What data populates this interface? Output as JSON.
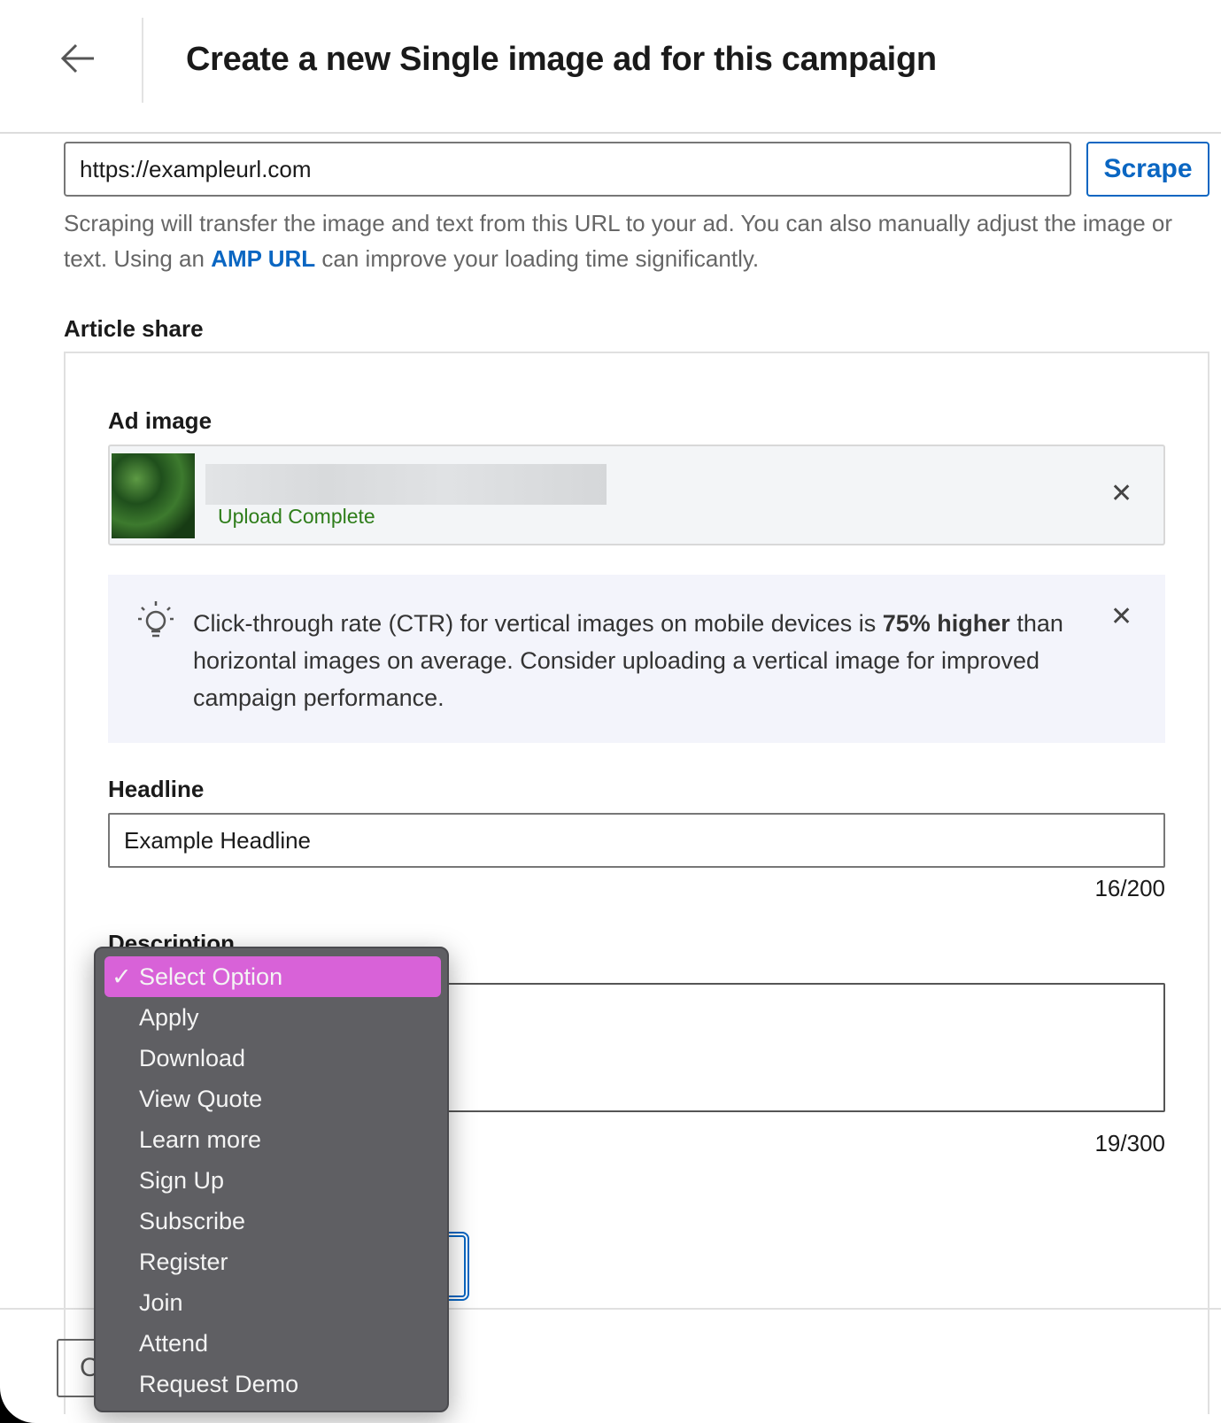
{
  "header": {
    "title": "Create a new Single image ad for this campaign",
    "back_icon": "arrow-left-icon"
  },
  "url": {
    "value": "https://exampleurl.com",
    "scrape_label": "Scrape"
  },
  "help": {
    "before": "Scraping will transfer the image and text from this URL to your ad. You can also manually adjust the image or text. Using an ",
    "link": "AMP URL",
    "after": " can improve your loading time significantly."
  },
  "article_share": {
    "label": "Article share"
  },
  "ad_image": {
    "label": "Ad image",
    "status": "Upload Complete"
  },
  "tip": {
    "before": "Click-through rate (CTR) for vertical images on mobile devices is ",
    "bold": "75% higher",
    "after": " than horizontal images on average. Consider uploading a vertical image for improved campaign performance."
  },
  "headline": {
    "label": "Headline",
    "value": "Example Headline",
    "counter": "16/200"
  },
  "description": {
    "label": "Description",
    "counter": "19/300"
  },
  "footer": {
    "cancel_partial": "C"
  },
  "dropdown": {
    "selected": "Select Option",
    "check": "✓",
    "options": [
      "Select Option",
      "Apply",
      "Download",
      "View Quote",
      "Learn more",
      "Sign Up",
      "Subscribe",
      "Register",
      "Join",
      "Attend",
      "Request Demo"
    ]
  },
  "colors": {
    "accent": "#0a66c2",
    "highlight": "#d862d8",
    "menu_bg": "#5f5f63",
    "success": "#2e7d1a"
  }
}
